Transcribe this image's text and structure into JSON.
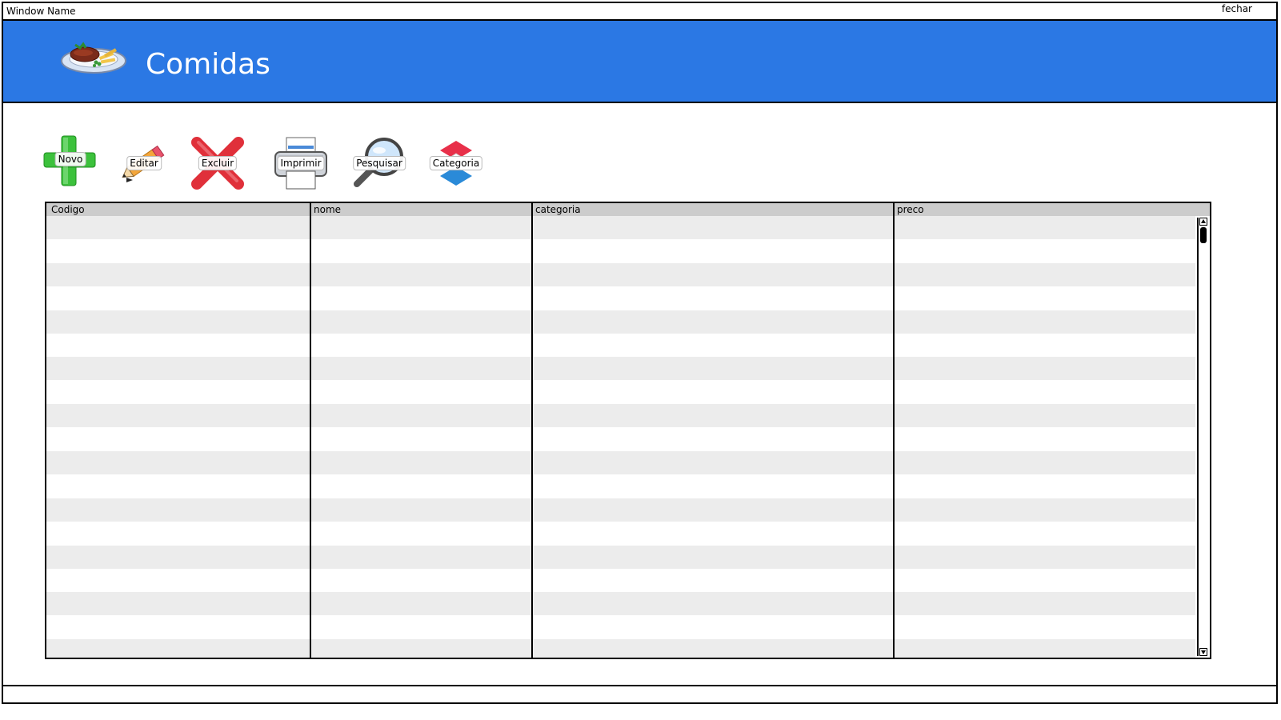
{
  "window": {
    "name": "Window Name",
    "close_label": "fechar"
  },
  "header": {
    "title": "Comidas",
    "logo_icon": "plate-food-icon",
    "background_color": "#2b78e4"
  },
  "toolbar": {
    "buttons": [
      {
        "label": "Novo",
        "icon": "plus-icon"
      },
      {
        "label": "Editar",
        "icon": "pencil-icon"
      },
      {
        "label": "Excluir",
        "icon": "x-delete-icon"
      },
      {
        "label": "Imprimir",
        "icon": "printer-icon"
      },
      {
        "label": "Pesquisar",
        "icon": "magnifier-icon"
      },
      {
        "label": "Categoria",
        "icon": "category-icon"
      }
    ]
  },
  "table": {
    "columns": [
      "Codigo",
      "nome",
      "categoria",
      "preco"
    ],
    "rows": [],
    "header_color": "#cccccc",
    "stripe_color": "#ececec"
  }
}
